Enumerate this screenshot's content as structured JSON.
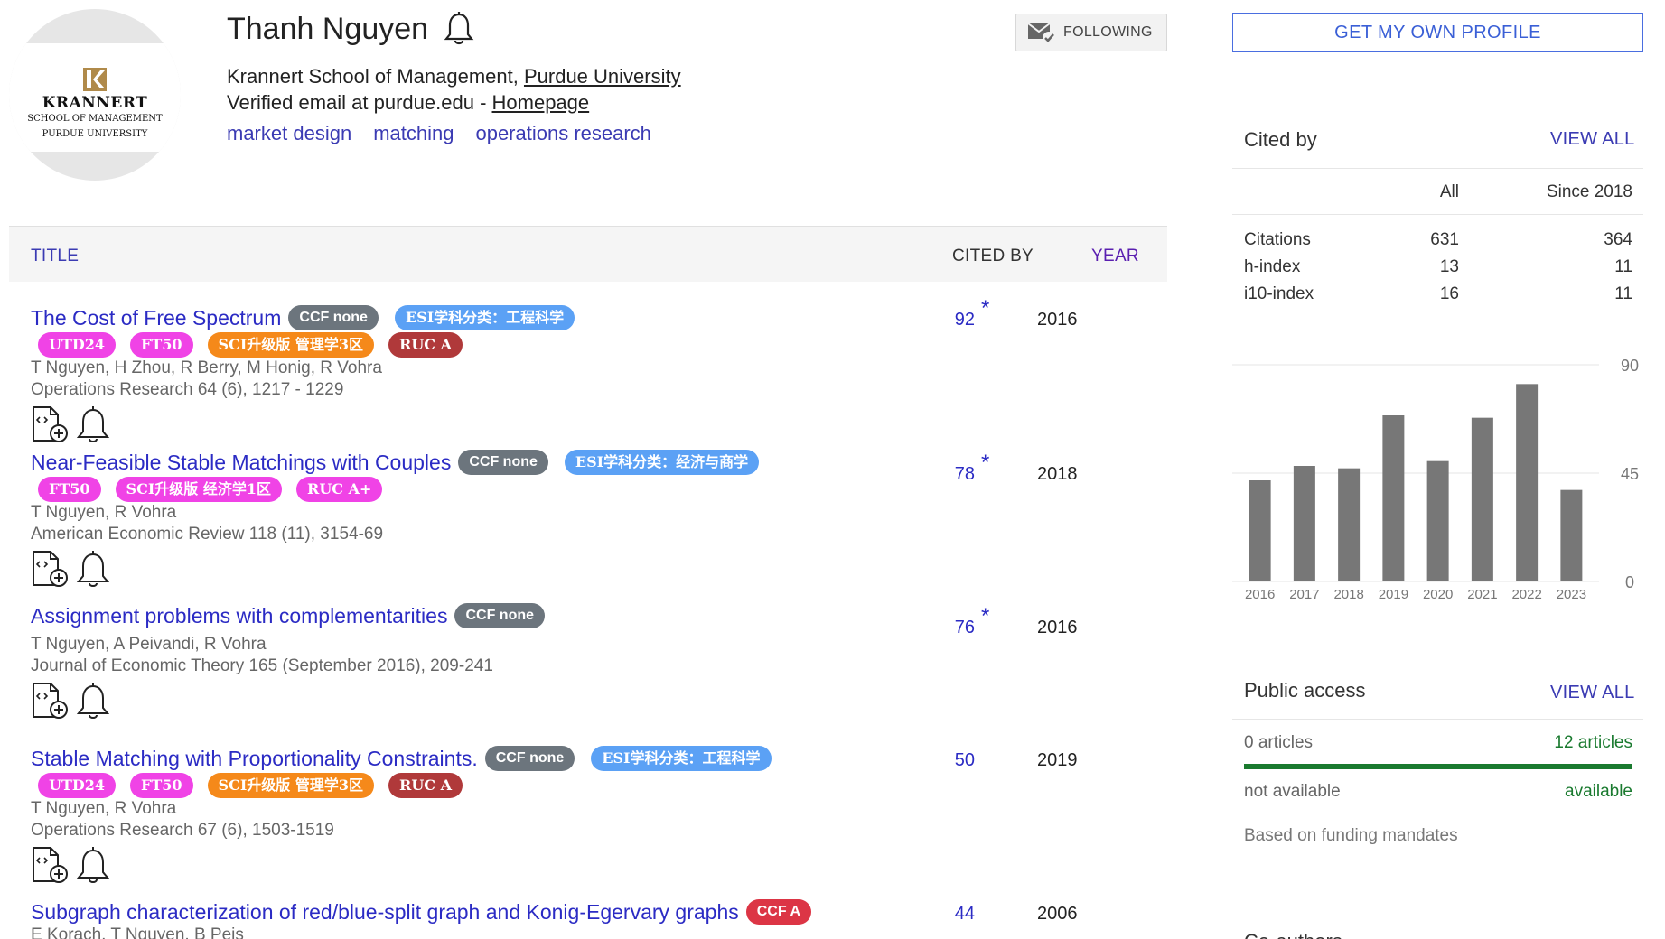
{
  "profile": {
    "name": "Thanh Nguyen",
    "affiliation_prefix": "Krannert School of Management, ",
    "affiliation_link": "Purdue University",
    "email_text": "Verified email at purdue.edu - ",
    "homepage_link": "Homepage",
    "interests": [
      "market design",
      "matching",
      "operations research"
    ],
    "logo": {
      "line1": "KRANNERT",
      "line2": "SCHOOL OF MANAGEMENT",
      "line3": "PURDUE UNIVERSITY"
    }
  },
  "follow_button": {
    "label": "FOLLOWING"
  },
  "table_header": {
    "title": "TITLE",
    "cited_by": "CITED BY",
    "year": "YEAR"
  },
  "articles": [
    {
      "title": "The Cost of Free Spectrum",
      "inline_badges": [
        "CCF none",
        "ESI学科分类：工程科学"
      ],
      "badges": [
        "UTD24",
        "FT50",
        "SCI升级版 管理学3区",
        "RUC A"
      ],
      "authors": "T Nguyen, H Zhou, R Berry, M Honig, R Vohra",
      "venue": "Operations Research 64 (6), 1217 - 1229",
      "cited_by": "92",
      "star": "*",
      "year": "2016"
    },
    {
      "title": "Near-Feasible Stable Matchings with Couples",
      "inline_badges": [
        "CCF none",
        "ESI学科分类：经济与商学"
      ],
      "badges": [
        "FT50",
        "SCI升级版 经济学1区",
        "RUC A+"
      ],
      "authors": "T Nguyen, R Vohra",
      "venue": "American Economic Review 118 (11), 3154-69",
      "cited_by": "78",
      "star": "*",
      "year": "2018"
    },
    {
      "title": "Assignment problems with complementarities",
      "inline_badges": [
        "CCF none"
      ],
      "badges": [],
      "authors": "T Nguyen, A Peivandi, R Vohra",
      "venue": "Journal of Economic Theory 165 (September 2016), 209-241",
      "cited_by": "76",
      "star": "*",
      "year": "2016"
    },
    {
      "title": "Stable Matching with Proportionality Constraints.",
      "inline_badges": [
        "CCF none",
        "ESI学科分类：工程科学"
      ],
      "badges": [
        "UTD24",
        "FT50",
        "SCI升级版 管理学3区",
        "RUC A"
      ],
      "authors": "T Nguyen, R Vohra",
      "venue": "Operations Research 67 (6), 1503-1519",
      "cited_by": "50",
      "star": "",
      "year": "2019"
    },
    {
      "title": "Subgraph characterization of red/blue-split graph and Konig-Egervary graphs",
      "inline_badges": [
        "CCF A"
      ],
      "badges": [],
      "authors": "E Korach, T Nguyen, B Peis",
      "venue": "",
      "cited_by": "44",
      "star": "",
      "year": "2006"
    }
  ],
  "badge_colors": {
    "CCF none": "#6c757d",
    "CCF A": "#dc3545",
    "ESI": "#5ba1f5",
    "UTD24": "#f043e6",
    "FT50": "#f043e6",
    "SCI": "#f5891a",
    "RUC A": "#b0393a",
    "RUC A+": "#f043e6"
  },
  "sidebar": {
    "own_profile_button": "GET MY OWN PROFILE",
    "cited_by": {
      "heading": "Cited by",
      "view_all": "VIEW ALL",
      "col_all": "All",
      "col_since": "Since 2018",
      "rows": [
        {
          "label": "Citations",
          "all": "631",
          "since": "364"
        },
        {
          "label": "h-index",
          "all": "13",
          "since": "11"
        },
        {
          "label": "i10-index",
          "all": "16",
          "since": "11"
        }
      ]
    },
    "public_access": {
      "heading": "Public access",
      "view_all": "VIEW ALL",
      "left_count": "0 articles",
      "right_count": "12 articles",
      "left_status": "not available",
      "right_status": "available",
      "note": "Based on funding mandates",
      "available_fraction": 1.0
    },
    "coauthors_heading": "Co-authors"
  },
  "chart_data": {
    "type": "bar",
    "categories": [
      "2016",
      "2017",
      "2018",
      "2019",
      "2020",
      "2021",
      "2022",
      "2023"
    ],
    "values": [
      42,
      48,
      47,
      69,
      50,
      68,
      82,
      38
    ],
    "ylim": [
      0,
      90
    ],
    "yticks": [
      "0",
      "45",
      "90"
    ],
    "bar_color": "#777777"
  }
}
